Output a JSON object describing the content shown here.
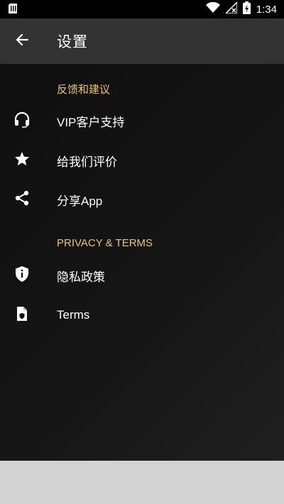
{
  "status_bar": {
    "time": "1:34",
    "icons": [
      "sim-card-icon",
      "wifi-icon",
      "no-signal-icon",
      "battery-charging-icon"
    ]
  },
  "app_bar": {
    "back_icon": "arrow-left-icon",
    "title": "设置"
  },
  "sections": [
    {
      "header": "反馈和建议",
      "items": [
        {
          "icon": "headset-icon",
          "label": "VIP客户支持"
        },
        {
          "icon": "star-icon",
          "label": "给我们评价"
        },
        {
          "icon": "share-icon",
          "label": "分享App"
        }
      ]
    },
    {
      "header": "PRIVACY & TERMS",
      "items": [
        {
          "icon": "shield-info-icon",
          "label": "隐私政策"
        },
        {
          "icon": "document-shield-icon",
          "label": "Terms"
        }
      ]
    }
  ],
  "colors": {
    "accent": "#e7c66a",
    "app_bar": "#333333",
    "background": "#121212",
    "status_bar": "#000000"
  }
}
